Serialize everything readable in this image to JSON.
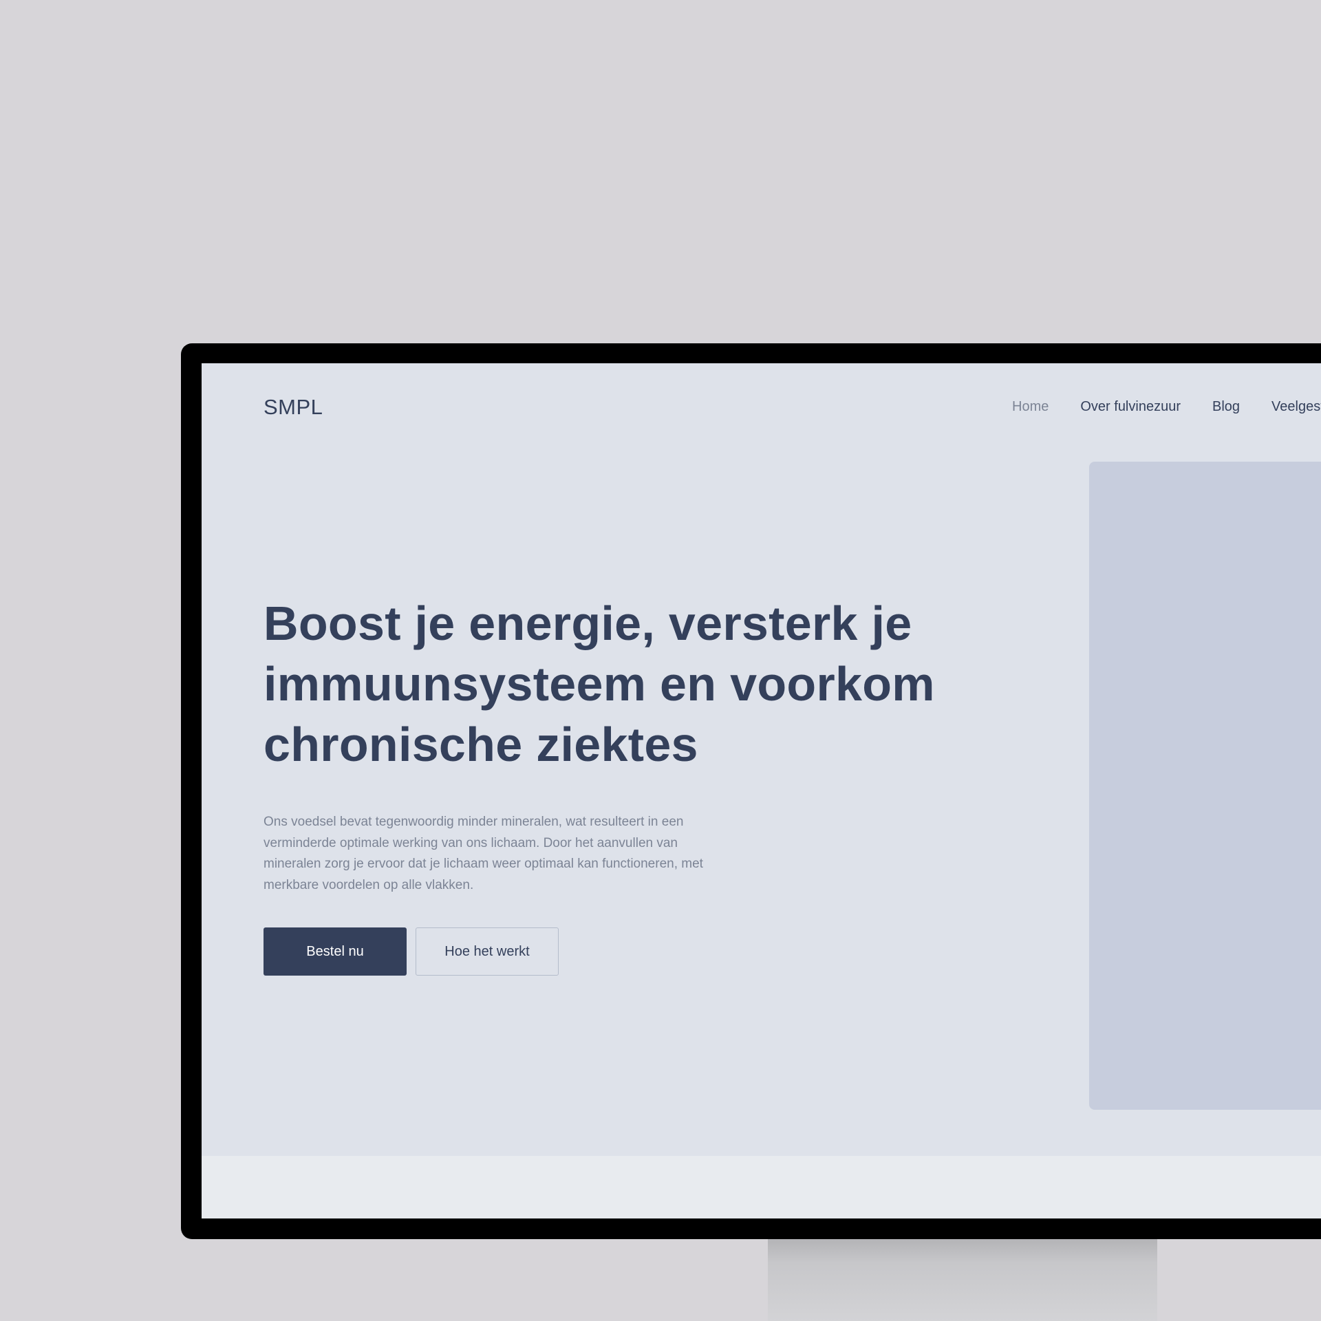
{
  "site": {
    "logo": "SMPL"
  },
  "nav": {
    "items": [
      {
        "label": "Home",
        "active": true
      },
      {
        "label": "Over fulvinezuur",
        "active": false
      },
      {
        "label": "Blog",
        "active": false
      },
      {
        "label": "Veelgestelde vragen",
        "active": false
      }
    ]
  },
  "hero": {
    "headline": "Boost je energie, versterk je immuunsysteem en voorkom chronische ziektes",
    "subtext": "Ons voedsel bevat tegenwoordig minder mineralen, wat resulteert in een verminderde optimale werking van ons lichaam. Door het aanvullen van mineralen zorg je ervoor dat je lichaam weer optimaal kan functioneren, met merkbare voordelen op alle vlakken.",
    "primary_button": "Bestel nu",
    "secondary_button": "Hoe het werkt"
  },
  "colors": {
    "background": "#d7d5d9",
    "screen": "#dee2ea",
    "text_dark": "#34405b",
    "text_muted": "#7c8495",
    "image_placeholder": "#c7cddd"
  }
}
